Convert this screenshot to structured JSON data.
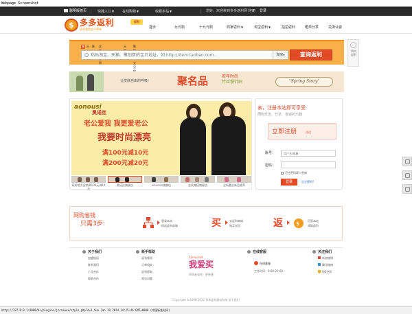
{
  "caption": "Webpage Screenshot",
  "topbar": {
    "home": "聪明版首页",
    "menus": [
      {
        "label": "快捷入口"
      },
      {
        "label": "在线购物"
      },
      {
        "label": "收藏本站"
      }
    ],
    "greeting": "您好，欢迎来到多多返利网！",
    "register": "注册",
    "login": "登录"
  },
  "header": {
    "logo_text": "多多返利",
    "logo_sub": "返利就是这么简单",
    "logo_badge": "返利",
    "nav": [
      {
        "label": "首页",
        "active": false
      },
      {
        "label": "九元购",
        "active": false
      },
      {
        "label": "十九元购",
        "active": false
      },
      {
        "label": "商家返利",
        "active": false,
        "dropdown": true
      },
      {
        "label": "淘宝返利",
        "active": false,
        "dropdown": true
      },
      {
        "label": "拍拍返利",
        "active": false
      },
      {
        "label": "晒单分享",
        "active": false
      },
      {
        "label": "兑换认装",
        "active": false
      }
    ]
  },
  "search": {
    "tabs": [
      "支持淘宝网",
      "天猫",
      "聚划算的宝贝链接"
    ],
    "placeholder": "粘贴淘宝、天猫、聚划算的宝贝地址，如:http://item.taobao.com...",
    "select_value": "淘宝",
    "button": "查询返利"
  },
  "banner": {
    "slogan": "让皮肤自由的呼吸!",
    "headline": "聚名品",
    "season": "若年时尚",
    "brand": "竹丝慢针织",
    "story": "\"Spring Story\""
  },
  "promo": {
    "brand": "aonousi",
    "brand_cn": "奥诺丝",
    "line1": "老公爱我  我更爱老公",
    "line2": "我要时尚漂亮",
    "coupon1": "满100元减10元",
    "coupon2": "满200元减20元",
    "captions": [
      "家纺馆大促销满100元减10元",
      "奥诺丝旗舰店",
      "villeison旗舰店",
      "金秋穿搭旗舰店",
      "全新蕾丝新品推荐"
    ]
  },
  "login": {
    "title": "亲，注册本站即可享受",
    "subtitle": "网购交流、分享、省钱的乐趣",
    "register_btn": "立即注册",
    "register_note": "试试",
    "account_label": "账号：",
    "account_placeholder": "用户名/邮箱",
    "password_label": "密码：",
    "password_placeholder": "",
    "remember": "记住密码两个星期",
    "login_btn": "登录",
    "forgot": "忘记密码?"
  },
  "steps": {
    "title1": "网购省钱",
    "title2": "只需3步:",
    "items": [
      {
        "line1": "登录本站",
        "line2": "挑选返利商城"
      },
      {
        "line1": "去返利商城",
        "line2": "购买东西"
      },
      {
        "line1": "回家本站",
        "line2": "领取返利"
      }
    ]
  },
  "footer": {
    "columns": [
      {
        "title": "关于我们",
        "links": [
          "加盟链接",
          "联系我们",
          "广告合作",
          "帮助合作"
        ]
      },
      {
        "title": "新手帮助",
        "links": [
          "返利规则",
          "订单相关",
          "返利提取",
          "常见问题"
        ]
      }
    ],
    "brand": {
      "url": "52mai.net",
      "slogan": "我爱买",
      "sub": "网购者省钱 · 更便捷"
    },
    "online": {
      "title": "在线客服",
      "qq": "在线客服",
      "hours": "工作时间：9:00-22:00"
    },
    "follow": {
      "title": "关注我们",
      "links": [
        "新浪微博",
        "腾讯微博",
        "QQ空间"
      ]
    },
    "copyright": "Copyright ©2008-2012   多多返利建站系统   关于我们"
  },
  "status": "http://127.0.0.1:8080/dc/plugins/jccaiwux/style.php?d=3 Sun Jan 19 2014 14:25:46 GMT+0800 (中国标准时间)",
  "side_float": "如何返利",
  "colors": {
    "accent": "#e04c2c",
    "search_band": "#fab04a",
    "topbar": "#2b2b2b"
  }
}
